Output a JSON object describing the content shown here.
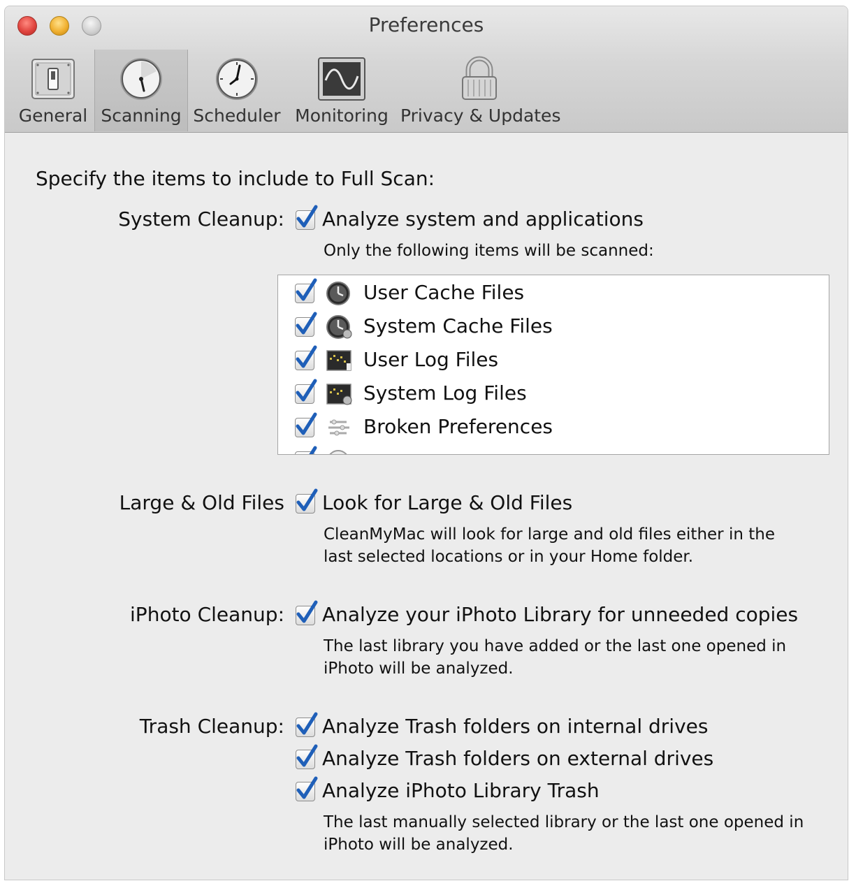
{
  "window": {
    "title": "Preferences"
  },
  "tabs": [
    {
      "label": "General",
      "icon": "toggle-switch-icon",
      "active": false
    },
    {
      "label": "Scanning",
      "icon": "scanning-gauge-icon",
      "active": true
    },
    {
      "label": "Scheduler",
      "icon": "clock-icon",
      "active": false
    },
    {
      "label": "Monitoring",
      "icon": "monitor-waveform-icon",
      "active": false
    },
    {
      "label": "Privacy & Updates",
      "icon": "padlock-icon",
      "active": false
    }
  ],
  "main": {
    "heading": "Specify the items to include to Full Scan:",
    "system_cleanup": {
      "label": "System Cleanup:",
      "option": "Analyze system and applications",
      "checked": true,
      "note": "Only the following items will be scanned:",
      "items": [
        {
          "label": "User Cache Files",
          "icon": "cache-clock-icon",
          "checked": true
        },
        {
          "label": "System Cache Files",
          "icon": "system-cache-clock-icon",
          "checked": true
        },
        {
          "label": "User Log Files",
          "icon": "log-file-icon",
          "checked": true
        },
        {
          "label": "System Log Files",
          "icon": "system-log-file-icon",
          "checked": true
        },
        {
          "label": "Broken Preferences",
          "icon": "broken-preferences-icon",
          "checked": true
        },
        {
          "label": "",
          "icon": "partially-hidden-item-icon",
          "checked": true
        }
      ]
    },
    "large_old_files": {
      "label": "Large & Old Files",
      "option": "Look for Large & Old Files",
      "checked": true,
      "note_line1": "CleanMyMac will look for large and old files either in the",
      "note_line2": "last selected locations or in your Home folder."
    },
    "iphoto_cleanup": {
      "label": "iPhoto Cleanup:",
      "option": "Analyze your iPhoto Library for unneeded copies",
      "checked": true,
      "note_line1": "The last library you have added or the last one opened in",
      "note_line2": "iPhoto will be analyzed."
    },
    "trash_cleanup": {
      "label": "Trash Cleanup:",
      "options": [
        {
          "label": "Analyze Trash folders on internal drives",
          "checked": true
        },
        {
          "label": "Analyze Trash folders on external drives",
          "checked": true
        },
        {
          "label": "Analyze iPhoto Library Trash",
          "checked": true
        }
      ],
      "note_line1": "The last manually selected library or the last one opened in",
      "note_line2": "iPhoto will be analyzed."
    }
  },
  "colors": {
    "checkmark": "#1f5fb8",
    "window_bg": "#ececec",
    "toolbar_bg": "#d6d6d6"
  }
}
